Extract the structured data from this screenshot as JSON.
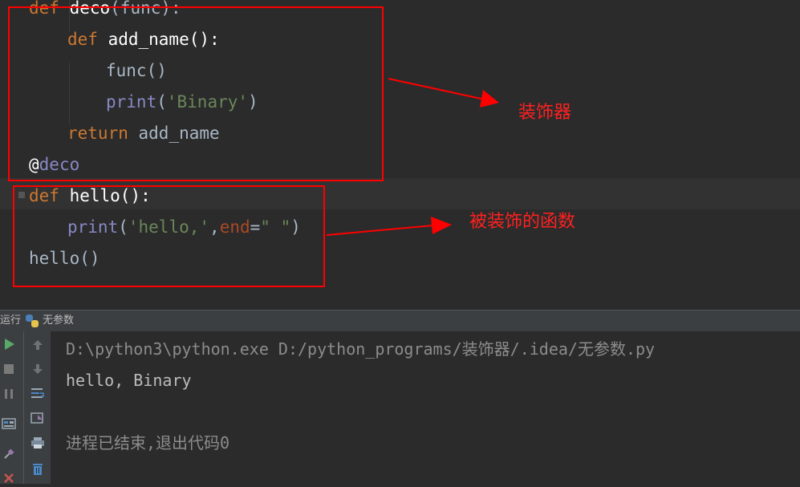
{
  "editor": {
    "lines": [
      {
        "parts": [
          {
            "t": "def ",
            "c": "kw"
          },
          {
            "t": "deco",
            "c": "sel"
          },
          {
            "t": "(func):",
            "c": "plain"
          }
        ]
      },
      {
        "parts": [
          {
            "t": "def ",
            "c": "kw"
          },
          {
            "t": "add_name",
            "c": "sel"
          },
          {
            "t": "():",
            "c": "sel"
          }
        ]
      },
      {
        "parts": [
          {
            "t": "func",
            "c": "plain"
          },
          {
            "t": "()",
            "c": "plain"
          }
        ]
      },
      {
        "parts": [
          {
            "t": "print",
            "c": "builtin"
          },
          {
            "t": "(",
            "c": "plain"
          },
          {
            "t": "'Binary'",
            "c": "str"
          },
          {
            "t": ")",
            "c": "plain"
          }
        ]
      },
      {
        "parts": [
          {
            "t": "return ",
            "c": "kw"
          },
          {
            "t": "add_name",
            "c": "plain"
          }
        ]
      },
      {
        "parts": [
          {
            "t": "@",
            "c": "sel"
          },
          {
            "t": "deco",
            "c": "builtin"
          }
        ]
      },
      {
        "parts": [
          {
            "t": "def ",
            "c": "kw"
          },
          {
            "t": "hello",
            "c": "sel"
          },
          {
            "t": "():",
            "c": "sel"
          }
        ]
      },
      {
        "parts": [
          {
            "t": "print",
            "c": "builtin"
          },
          {
            "t": "(",
            "c": "plain"
          },
          {
            "t": "'hello,'",
            "c": "str"
          },
          {
            "t": ",",
            "c": "plain"
          },
          {
            "t": "end",
            "c": "param"
          },
          {
            "t": "=",
            "c": "plain"
          },
          {
            "t": "\" \"",
            "c": "str"
          },
          {
            "t": ")",
            "c": "plain"
          }
        ]
      },
      {
        "parts": [
          {
            "t": "hello",
            "c": "plain"
          },
          {
            "t": "()",
            "c": "plain"
          }
        ]
      }
    ]
  },
  "annotations": {
    "decorator_label": "装饰器",
    "decorated_label": "被装饰的函数"
  },
  "run_panel": {
    "tab_label": "运行",
    "config_name": "无参数",
    "console_lines": [
      "D:\\python3\\python.exe D:/python_programs/装饰器/.idea/无参数.py",
      "hello, Binary",
      "",
      "进程已结束,退出代码0"
    ]
  },
  "colors": {
    "annotation_red": "#ff0000",
    "editor_bg": "#2b2b2b",
    "toolbar_bg": "#3c3f41"
  },
  "icons": {
    "left_toolbar": [
      "run-icon",
      "stop-icon",
      "pause-icon",
      "layout-icon",
      "pin-icon",
      "close-icon"
    ],
    "mid_toolbar": [
      "scroll-up-icon",
      "scroll-down-icon",
      "soft-wrap-icon",
      "scroll-to-end-icon",
      "print-icon",
      "trash-icon"
    ]
  }
}
